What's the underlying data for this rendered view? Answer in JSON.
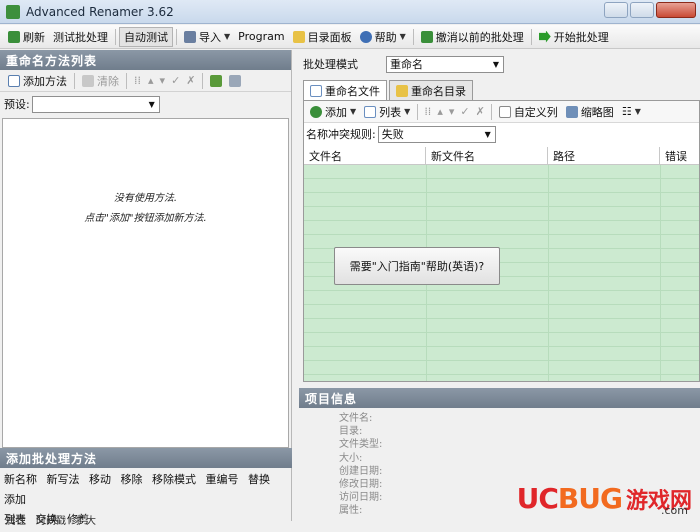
{
  "window": {
    "title": "Advanced Renamer 3.62"
  },
  "toolbar": {
    "refresh": "刷新",
    "test_batch": "测试批处理",
    "auto_test": "自动测试",
    "import": "导入",
    "program": "Program",
    "dir_panel": "目录面板",
    "help": "帮助",
    "undo_batch": "撤消以前的批处理",
    "start_batch": "开始批处理"
  },
  "left": {
    "methods_header": "重命名方法列表",
    "add_method": "添加方法",
    "clear": "清除",
    "preset_label": "预设:",
    "empty_line1": "没有使用方法.",
    "empty_line2": "点击\"添加\"按钮添加新方法.",
    "add_batch_header": "添加批处理方法",
    "batch_methods": [
      "新名称",
      "新写法",
      "移动",
      "移除",
      "移除模式",
      "重编号",
      "替换",
      "添加",
      "列表",
      "交换",
      "修剪"
    ],
    "bottom_tabs": [
      "属性",
      "时间戳",
      "扩大"
    ]
  },
  "right": {
    "batch_mode_label": "批处理模式",
    "batch_mode_value": "重命名",
    "tabs": [
      "重命名文件",
      "重命名目录"
    ],
    "add": "添加",
    "list": "列表",
    "custom_cols": "自定义列",
    "thumbnails": "缩略图",
    "conflict_label": "名称冲突规则:",
    "conflict_value": "失败",
    "columns": [
      "文件名",
      "新文件名",
      "路径",
      "错误"
    ],
    "help_button": "需要\"入门指南\"帮助(英语)?",
    "info_header": "项目信息",
    "info_fields": [
      "文件名:",
      "目录:",
      "文件类型:",
      "大小:",
      "创建日期:",
      "修改日期:",
      "访问日期:",
      "属性:"
    ]
  },
  "watermark": {
    "logo_uc": "UC",
    "logo_bug": "BUG",
    "cn": "游戏网",
    "url": ".com"
  },
  "colors": {
    "grid_bg": "#ccead0",
    "header_bg": "#7c8998",
    "watermark_red": "#e0262a"
  }
}
